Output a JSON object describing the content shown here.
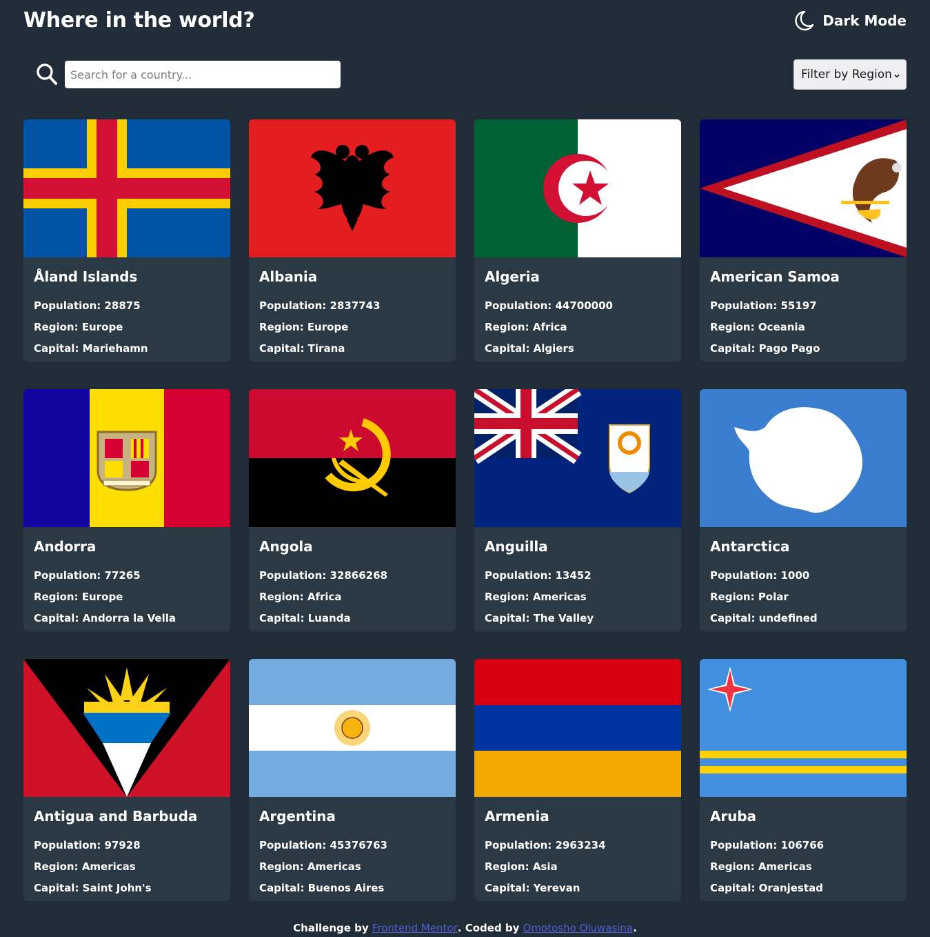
{
  "header": {
    "title": "Where in the world?",
    "mode_label": "Dark Mode",
    "mode_icon": "moon-icon"
  },
  "search": {
    "placeholder": "Search for a country...",
    "value": "",
    "icon": "search-icon"
  },
  "filter": {
    "label": "Filter by Region"
  },
  "labels": {
    "population": "Population: ",
    "region": "Region: ",
    "capital": "Capital: "
  },
  "countries": [
    {
      "name": "Åland Islands",
      "population": "28875",
      "region": "Europe",
      "capital": "Mariehamn",
      "flag": "aland-flag"
    },
    {
      "name": "Albania",
      "population": "2837743",
      "region": "Europe",
      "capital": "Tirana",
      "flag": "albania-flag"
    },
    {
      "name": "Algeria",
      "population": "44700000",
      "region": "Africa",
      "capital": "Algiers",
      "flag": "algeria-flag"
    },
    {
      "name": "American Samoa",
      "population": "55197",
      "region": "Oceania",
      "capital": "Pago Pago",
      "flag": "american-samoa-flag"
    },
    {
      "name": "Andorra",
      "population": "77265",
      "region": "Europe",
      "capital": "Andorra la Vella",
      "flag": "andorra-flag"
    },
    {
      "name": "Angola",
      "population": "32866268",
      "region": "Africa",
      "capital": "Luanda",
      "flag": "angola-flag"
    },
    {
      "name": "Anguilla",
      "population": "13452",
      "region": "Americas",
      "capital": "The Valley",
      "flag": "anguilla-flag"
    },
    {
      "name": "Antarctica",
      "population": "1000",
      "region": "Polar",
      "capital": "undefined",
      "flag": "antarctica-flag"
    },
    {
      "name": "Antigua and Barbuda",
      "population": "97928",
      "region": "Americas",
      "capital": "Saint John's",
      "flag": "antigua-flag"
    },
    {
      "name": "Argentina",
      "population": "45376763",
      "region": "Americas",
      "capital": "Buenos Aires",
      "flag": "argentina-flag"
    },
    {
      "name": "Armenia",
      "population": "2963234",
      "region": "Asia",
      "capital": "Yerevan",
      "flag": "armenia-flag"
    },
    {
      "name": "Aruba",
      "population": "106766",
      "region": "Americas",
      "capital": "Oranjestad",
      "flag": "aruba-flag"
    }
  ],
  "footer": {
    "prefix": "Challenge by ",
    "link1": "Frontend Mentor",
    "middle": ". Coded by ",
    "link2": "Omotosho Oluwasina",
    "suffix": "."
  },
  "colors": {
    "background": "#202c37",
    "card": "#2b3945",
    "link": "#4f5ecf"
  }
}
